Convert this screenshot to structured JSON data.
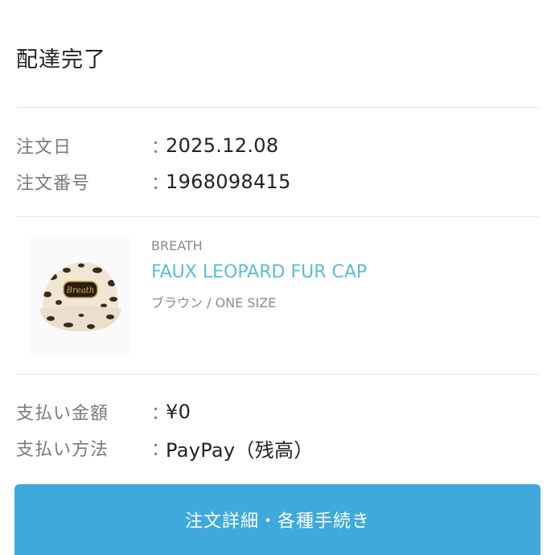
{
  "status": {
    "title": "配達完了"
  },
  "order": {
    "date_label": "注文日",
    "date_value": "2025.12.08",
    "number_label": "注文番号",
    "number_value": "1968098415",
    "colon": "："
  },
  "product": {
    "image_icon": "leopard-cap-image",
    "cap_logo_text": "Breath",
    "brand": "BREATH",
    "name": "FAUX LEOPARD FUR CAP",
    "variant": "ブラウン / ONE SIZE"
  },
  "payment": {
    "amount_label": "支払い金額",
    "amount_value": "¥0",
    "method_label": "支払い方法",
    "method_value": "PayPay（残高）",
    "colon": "："
  },
  "actions": {
    "details_button": "注文詳細・各種手続き"
  },
  "colors": {
    "accent_button": "#3fa9dc",
    "product_link": "#5bbdd2",
    "label_gray": "#7a7a7a"
  }
}
